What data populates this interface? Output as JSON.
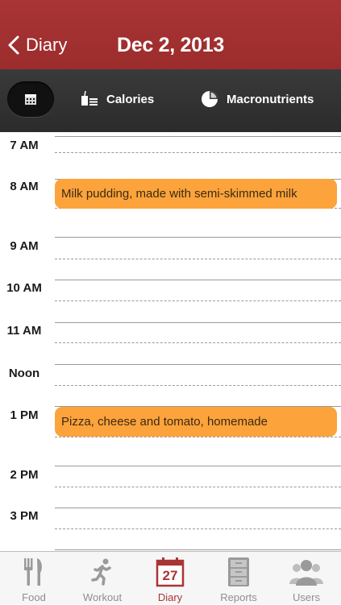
{
  "header": {
    "back_label": "Diary",
    "title": "Dec 2, 2013"
  },
  "toolbar": {
    "calories_label": "Calories",
    "macronutrients_label": "Macronutrients"
  },
  "dayview": {
    "hours": [
      "7 AM",
      "8 AM",
      "9 AM",
      "10 AM",
      "11 AM",
      "Noon",
      "1 PM",
      "2 PM",
      "3 PM"
    ],
    "events": [
      {
        "hour": "8 AM",
        "label": "Milk pudding, made with semi-skimmed milk"
      },
      {
        "hour": "1 PM",
        "label": "Pizza, cheese and tomato, homemade"
      }
    ]
  },
  "tabbar": {
    "tabs": [
      {
        "label": "Food",
        "icon": "fork-knife-icon"
      },
      {
        "label": "Workout",
        "icon": "running-person-icon"
      },
      {
        "label": "Diary",
        "icon": "calendar-icon",
        "badge": "27",
        "active": true
      },
      {
        "label": "Reports",
        "icon": "file-cabinet-icon"
      },
      {
        "label": "Users",
        "icon": "users-icon"
      }
    ]
  },
  "colors": {
    "header": "#a93535",
    "toolbar": "#2f2f2f",
    "event": "#fda33b",
    "active_tab": "#a93535"
  }
}
